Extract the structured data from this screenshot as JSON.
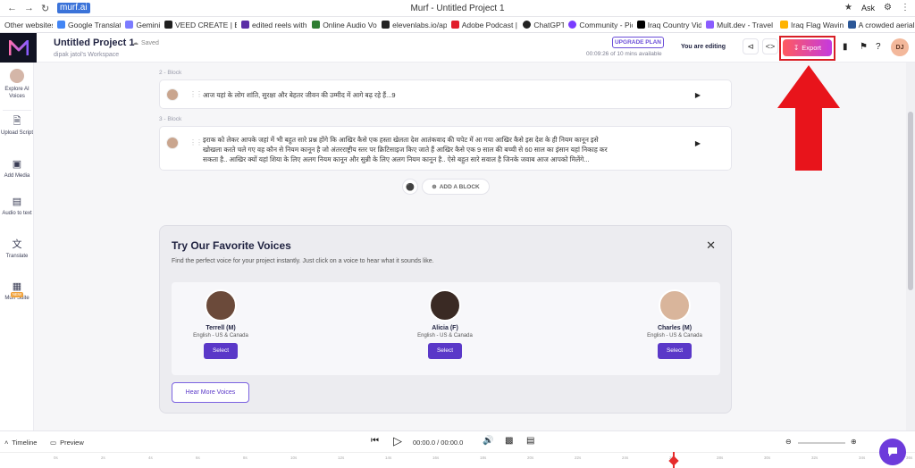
{
  "browser": {
    "url": "murf.ai",
    "window_title": "Murf - Untitled Project 1",
    "ask_label": "Ask",
    "bookmarks": [
      {
        "label": "Other websites",
        "color": "#ffffff"
      },
      {
        "label": "Google Translate",
        "color": "#4285f4"
      },
      {
        "label": "Gemini",
        "color": "#7b7bff"
      },
      {
        "label": "VEED CREATE | Ed",
        "color": "#1f1f1f"
      },
      {
        "label": "edited reels with c",
        "color": "#5b2ea6"
      },
      {
        "label": "Online Audio Voic",
        "color": "#2e7d32"
      },
      {
        "label": "elevenlabs.io/app",
        "color": "#222222"
      },
      {
        "label": "Adobe Podcast | A",
        "color": "#e11d2a"
      },
      {
        "label": "ChatGPT",
        "color": "#222222"
      },
      {
        "label": "Community - Pict",
        "color": "#7a3cff"
      },
      {
        "label": "Iraq Country Vide",
        "color": "#000000"
      },
      {
        "label": "Mult.dev - Travel M",
        "color": "#8a5cff"
      },
      {
        "label": "Iraq Flag Waving",
        "color": "#ffb300"
      },
      {
        "label": "A crowded aerial v",
        "color": "#2b5797"
      }
    ]
  },
  "header": {
    "project_title": "Untitled Project 1",
    "saved_label": "Saved",
    "workspace": "dipak jatol's Workspace",
    "upgrade_label": "UPGRADE PLAN",
    "usage_text": "00:09:26 of 10 mins available",
    "editing_label": "You are editing",
    "export_label": "Export",
    "avatar_initials": "DJ"
  },
  "sidebar": {
    "items": [
      {
        "label": "Explore AI Voices",
        "icon": "voices-avatar-icon"
      },
      {
        "label": "Upload Script",
        "icon": "upload-script-icon"
      },
      {
        "label": "Add Media",
        "icon": "add-media-icon"
      },
      {
        "label": "Audio to text",
        "icon": "audio-to-text-icon"
      },
      {
        "label": "Translate",
        "icon": "translate-icon"
      },
      {
        "label": "Murf Suite",
        "icon": "murf-suite-icon",
        "badge": "NEW"
      }
    ]
  },
  "blocks": [
    {
      "label": "2 - Block",
      "text": "आज यहां के लोग शांति, सुरक्षा और बेहतर जीवन की उम्मीद में आगे बढ़ रहे हैं...9"
    },
    {
      "label": "3 - Block",
      "text_line1": "इराक को लेकर आपके जहां में भी बहुत सारे प्रश्न होंगे कि आखिर कैसे एक हस्ता खेलता देश आतंकवाद की चपेट में आ गया आखिर कैसे इस देश के ही नियम कानून इसे",
      "text_line2": "खोखला करते चले गए वह कौन से नियम कानून है जो अंतरराष्ट्रीय स्तर पर क्रिटिसाइज किए जाते हैं आखिर कैसे एक 9 साल की बच्ची से 60 साल का इंसान यहां निकाह कर",
      "text_line3": "सकता है.. आखिर क्यों यहां शिया के लिए अलग नियम कानून और सुन्नी के लिए अलग नियम कानून है.. ऐसे बहुत सारे सवाल है जिनके जवाब आज आपको मिलेंगे..."
    }
  ],
  "add_block_label": "ADD A BLOCK",
  "voices_panel": {
    "title": "Try Our Favorite Voices",
    "description": "Find the perfect voice for your project instantly. Just click on a voice to hear what it sounds like.",
    "voices": [
      {
        "name": "Terrell (M)",
        "locale": "English - US & Canada",
        "select": "Select",
        "face_color": "#6b4a3a"
      },
      {
        "name": "Alicia (F)",
        "locale": "English - US & Canada",
        "select": "Select",
        "face_color": "#3a2a24"
      },
      {
        "name": "Charles (M)",
        "locale": "English - US & Canada",
        "select": "Select",
        "face_color": "#d9b59b"
      }
    ],
    "hear_more_label": "Hear More Voices"
  },
  "timeline": {
    "timeline_label": "Timeline",
    "preview_label": "Preview",
    "time_display": "00:00.0 / 00:00.0",
    "ticks": [
      "0s",
      "2s",
      "4s",
      "6s",
      "8s",
      "10s",
      "12s",
      "14s",
      "16s",
      "18s",
      "20s",
      "22s",
      "24s",
      "26s",
      "28s",
      "30s",
      "32s",
      "34s",
      "36s",
      "38s"
    ]
  },
  "colors": {
    "accent": "#5a38c8",
    "export_gradient_start": "#ff5a5f",
    "export_gradient_end": "#c43adf",
    "annotation_red": "#e8141b"
  }
}
